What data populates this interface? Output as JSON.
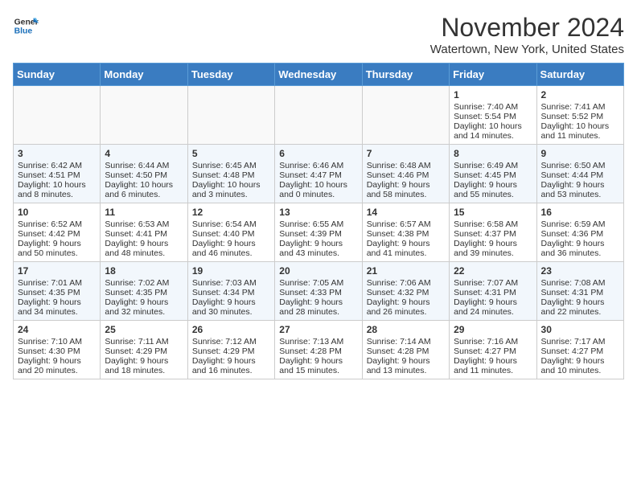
{
  "header": {
    "logo_line1": "General",
    "logo_line2": "Blue",
    "month": "November 2024",
    "location": "Watertown, New York, United States"
  },
  "days_of_week": [
    "Sunday",
    "Monday",
    "Tuesday",
    "Wednesday",
    "Thursday",
    "Friday",
    "Saturday"
  ],
  "weeks": [
    [
      {
        "day": "",
        "text": ""
      },
      {
        "day": "",
        "text": ""
      },
      {
        "day": "",
        "text": ""
      },
      {
        "day": "",
        "text": ""
      },
      {
        "day": "",
        "text": ""
      },
      {
        "day": "1",
        "text": "Sunrise: 7:40 AM\nSunset: 5:54 PM\nDaylight: 10 hours and 14 minutes."
      },
      {
        "day": "2",
        "text": "Sunrise: 7:41 AM\nSunset: 5:52 PM\nDaylight: 10 hours and 11 minutes."
      }
    ],
    [
      {
        "day": "3",
        "text": "Sunrise: 6:42 AM\nSunset: 4:51 PM\nDaylight: 10 hours and 8 minutes."
      },
      {
        "day": "4",
        "text": "Sunrise: 6:44 AM\nSunset: 4:50 PM\nDaylight: 10 hours and 6 minutes."
      },
      {
        "day": "5",
        "text": "Sunrise: 6:45 AM\nSunset: 4:48 PM\nDaylight: 10 hours and 3 minutes."
      },
      {
        "day": "6",
        "text": "Sunrise: 6:46 AM\nSunset: 4:47 PM\nDaylight: 10 hours and 0 minutes."
      },
      {
        "day": "7",
        "text": "Sunrise: 6:48 AM\nSunset: 4:46 PM\nDaylight: 9 hours and 58 minutes."
      },
      {
        "day": "8",
        "text": "Sunrise: 6:49 AM\nSunset: 4:45 PM\nDaylight: 9 hours and 55 minutes."
      },
      {
        "day": "9",
        "text": "Sunrise: 6:50 AM\nSunset: 4:44 PM\nDaylight: 9 hours and 53 minutes."
      }
    ],
    [
      {
        "day": "10",
        "text": "Sunrise: 6:52 AM\nSunset: 4:42 PM\nDaylight: 9 hours and 50 minutes."
      },
      {
        "day": "11",
        "text": "Sunrise: 6:53 AM\nSunset: 4:41 PM\nDaylight: 9 hours and 48 minutes."
      },
      {
        "day": "12",
        "text": "Sunrise: 6:54 AM\nSunset: 4:40 PM\nDaylight: 9 hours and 46 minutes."
      },
      {
        "day": "13",
        "text": "Sunrise: 6:55 AM\nSunset: 4:39 PM\nDaylight: 9 hours and 43 minutes."
      },
      {
        "day": "14",
        "text": "Sunrise: 6:57 AM\nSunset: 4:38 PM\nDaylight: 9 hours and 41 minutes."
      },
      {
        "day": "15",
        "text": "Sunrise: 6:58 AM\nSunset: 4:37 PM\nDaylight: 9 hours and 39 minutes."
      },
      {
        "day": "16",
        "text": "Sunrise: 6:59 AM\nSunset: 4:36 PM\nDaylight: 9 hours and 36 minutes."
      }
    ],
    [
      {
        "day": "17",
        "text": "Sunrise: 7:01 AM\nSunset: 4:35 PM\nDaylight: 9 hours and 34 minutes."
      },
      {
        "day": "18",
        "text": "Sunrise: 7:02 AM\nSunset: 4:35 PM\nDaylight: 9 hours and 32 minutes."
      },
      {
        "day": "19",
        "text": "Sunrise: 7:03 AM\nSunset: 4:34 PM\nDaylight: 9 hours and 30 minutes."
      },
      {
        "day": "20",
        "text": "Sunrise: 7:05 AM\nSunset: 4:33 PM\nDaylight: 9 hours and 28 minutes."
      },
      {
        "day": "21",
        "text": "Sunrise: 7:06 AM\nSunset: 4:32 PM\nDaylight: 9 hours and 26 minutes."
      },
      {
        "day": "22",
        "text": "Sunrise: 7:07 AM\nSunset: 4:31 PM\nDaylight: 9 hours and 24 minutes."
      },
      {
        "day": "23",
        "text": "Sunrise: 7:08 AM\nSunset: 4:31 PM\nDaylight: 9 hours and 22 minutes."
      }
    ],
    [
      {
        "day": "24",
        "text": "Sunrise: 7:10 AM\nSunset: 4:30 PM\nDaylight: 9 hours and 20 minutes."
      },
      {
        "day": "25",
        "text": "Sunrise: 7:11 AM\nSunset: 4:29 PM\nDaylight: 9 hours and 18 minutes."
      },
      {
        "day": "26",
        "text": "Sunrise: 7:12 AM\nSunset: 4:29 PM\nDaylight: 9 hours and 16 minutes."
      },
      {
        "day": "27",
        "text": "Sunrise: 7:13 AM\nSunset: 4:28 PM\nDaylight: 9 hours and 15 minutes."
      },
      {
        "day": "28",
        "text": "Sunrise: 7:14 AM\nSunset: 4:28 PM\nDaylight: 9 hours and 13 minutes."
      },
      {
        "day": "29",
        "text": "Sunrise: 7:16 AM\nSunset: 4:27 PM\nDaylight: 9 hours and 11 minutes."
      },
      {
        "day": "30",
        "text": "Sunrise: 7:17 AM\nSunset: 4:27 PM\nDaylight: 9 hours and 10 minutes."
      }
    ]
  ]
}
